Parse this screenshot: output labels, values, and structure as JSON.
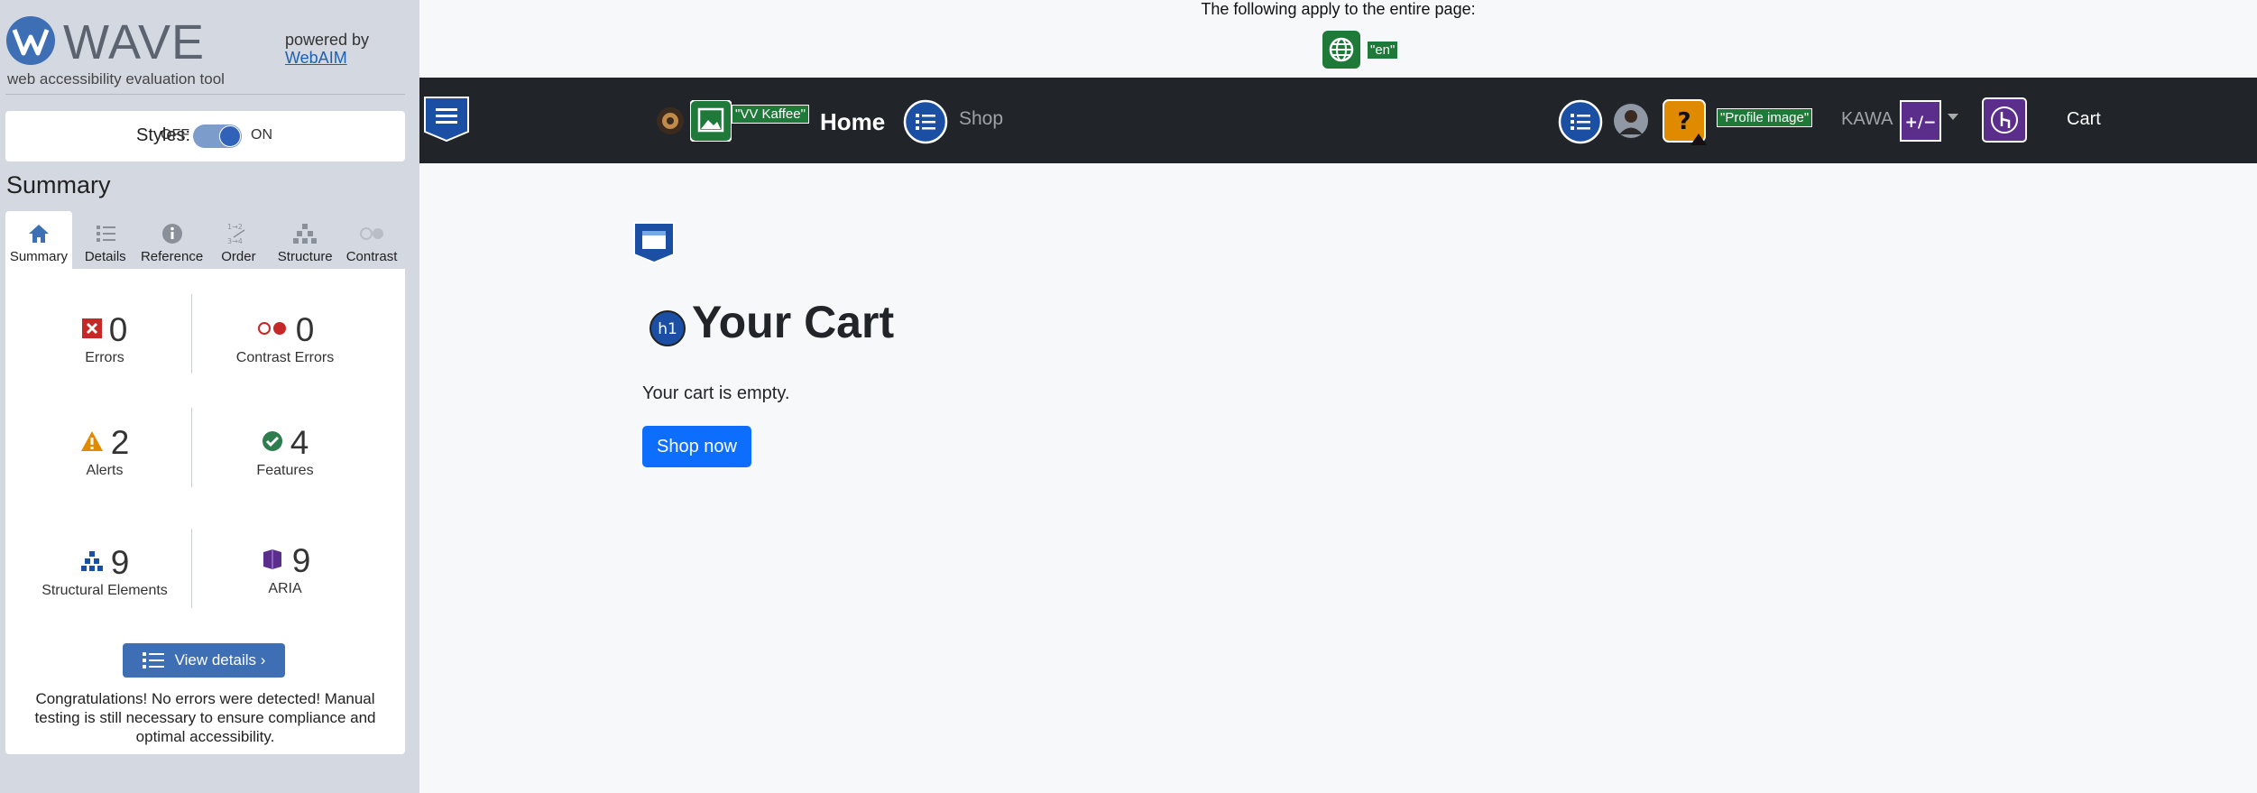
{
  "wave": {
    "logo_text": "WAVE",
    "subtitle": "web accessibility evaluation tool",
    "powered_by": "powered by",
    "webaim_link": "WebAIM",
    "styles_label": "Styles:",
    "off_label": "OFF",
    "on_label": "ON",
    "summary_heading": "Summary",
    "tabs": [
      {
        "label": "Summary",
        "icon": "home-icon",
        "active": true
      },
      {
        "label": "Details",
        "icon": "list-icon",
        "active": false
      },
      {
        "label": "Reference",
        "icon": "info-icon",
        "active": false
      },
      {
        "label": "Order",
        "icon": "order-icon",
        "active": false
      },
      {
        "label": "Structure",
        "icon": "structure-icon",
        "active": false
      },
      {
        "label": "Contrast",
        "icon": "contrast-icon",
        "active": false
      }
    ],
    "stats": {
      "errors": {
        "value": "0",
        "label": "Errors"
      },
      "contrast_errors": {
        "value": "0",
        "label": "Contrast Errors"
      },
      "alerts": {
        "value": "2",
        "label": "Alerts"
      },
      "features": {
        "value": "4",
        "label": "Features"
      },
      "structural": {
        "value": "9",
        "label": "Structural Elements"
      },
      "aria": {
        "value": "9",
        "label": "ARIA"
      }
    },
    "view_details": "View details ›",
    "congrats": "Congratulations! No errors were detected! Manual testing is still necessary to ensure compliance and optimal accessibility."
  },
  "page": {
    "note": "The following apply to the entire page:",
    "lang_badge": "\"en\"",
    "nav": {
      "brand_badge": "\"VV Kaffee\"",
      "home": "Home",
      "shop": "Shop",
      "profile_badge": "\"Profile image\"",
      "user": "KAWA",
      "cart": "Cart"
    },
    "h1_badge": "h1",
    "title": "Your Cart",
    "empty_text": "Your cart is empty.",
    "shop_now": "Shop now"
  },
  "colors": {
    "sidebar_bg": "#d4d9e1",
    "navbar_bg": "#212529",
    "primary_button": "#0d6efd",
    "wave_button": "#3e6fb5",
    "feature_green": "#1f7a3a",
    "aria_purple": "#5b2e8c",
    "structure_blue": "#1a4fa3"
  }
}
